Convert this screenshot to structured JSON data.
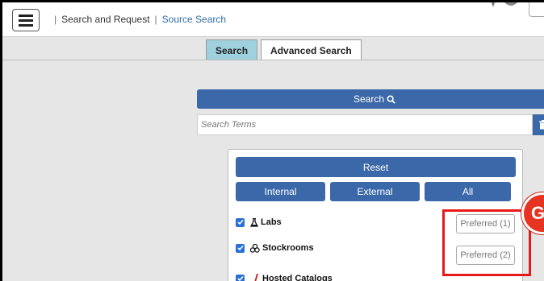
{
  "header": {
    "crumb_section": "Search and Request",
    "crumb_page": "Source Search"
  },
  "tabs": [
    {
      "label": "Search",
      "active": true
    },
    {
      "label": "Advanced Search",
      "active": false
    }
  ],
  "search": {
    "button_label": "Search",
    "placeholder": "Search Terms",
    "value": ""
  },
  "panel": {
    "reset_label": "Reset",
    "filters": [
      "Internal",
      "External",
      "All"
    ],
    "sources": [
      {
        "label": "Labs",
        "checked": true,
        "icon": "flask-icon",
        "preferred_label": "Preferred (1)"
      },
      {
        "label": "Stockrooms",
        "checked": true,
        "icon": "stockroom-icon",
        "preferred_label": "Preferred (2)"
      },
      {
        "label": "Hosted Catalogs",
        "checked": true,
        "icon": "catalog-icon",
        "preferred_label": ""
      }
    ]
  },
  "callout": {
    "text": "G"
  },
  "colors": {
    "primary": "#3b68a8",
    "active_tab": "#9fd0de",
    "highlight": "#e8181b",
    "callout": "#e53422",
    "link": "#2e6da4"
  }
}
